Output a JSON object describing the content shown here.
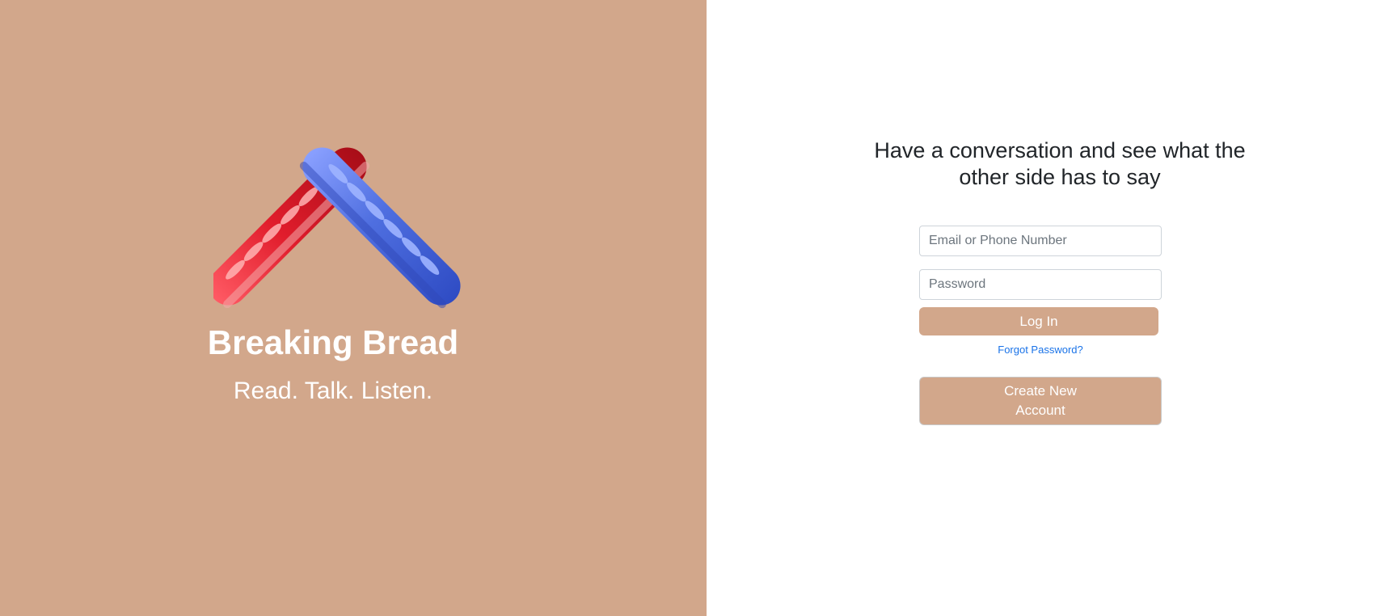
{
  "brand": {
    "title": "Breaking Bread",
    "tagline": "Read. Talk. Listen.",
    "logo_icon": "crossed-baguettes-logo",
    "colors": {
      "panel": "#d2a78b",
      "baguette_left": "#e11d2c",
      "baguette_right": "#4f6fe0"
    }
  },
  "login": {
    "headline": "Have a conversation and see what the other side has to say",
    "email_placeholder": "Email or Phone Number",
    "email_value": "",
    "password_placeholder": "Password",
    "password_value": "",
    "login_label": "Log In",
    "forgot_label": "Forgot Password?",
    "create_label": "Create New Account",
    "colors": {
      "button": "#d2a78b",
      "link": "#1a73e8",
      "headline": "#212529"
    }
  }
}
